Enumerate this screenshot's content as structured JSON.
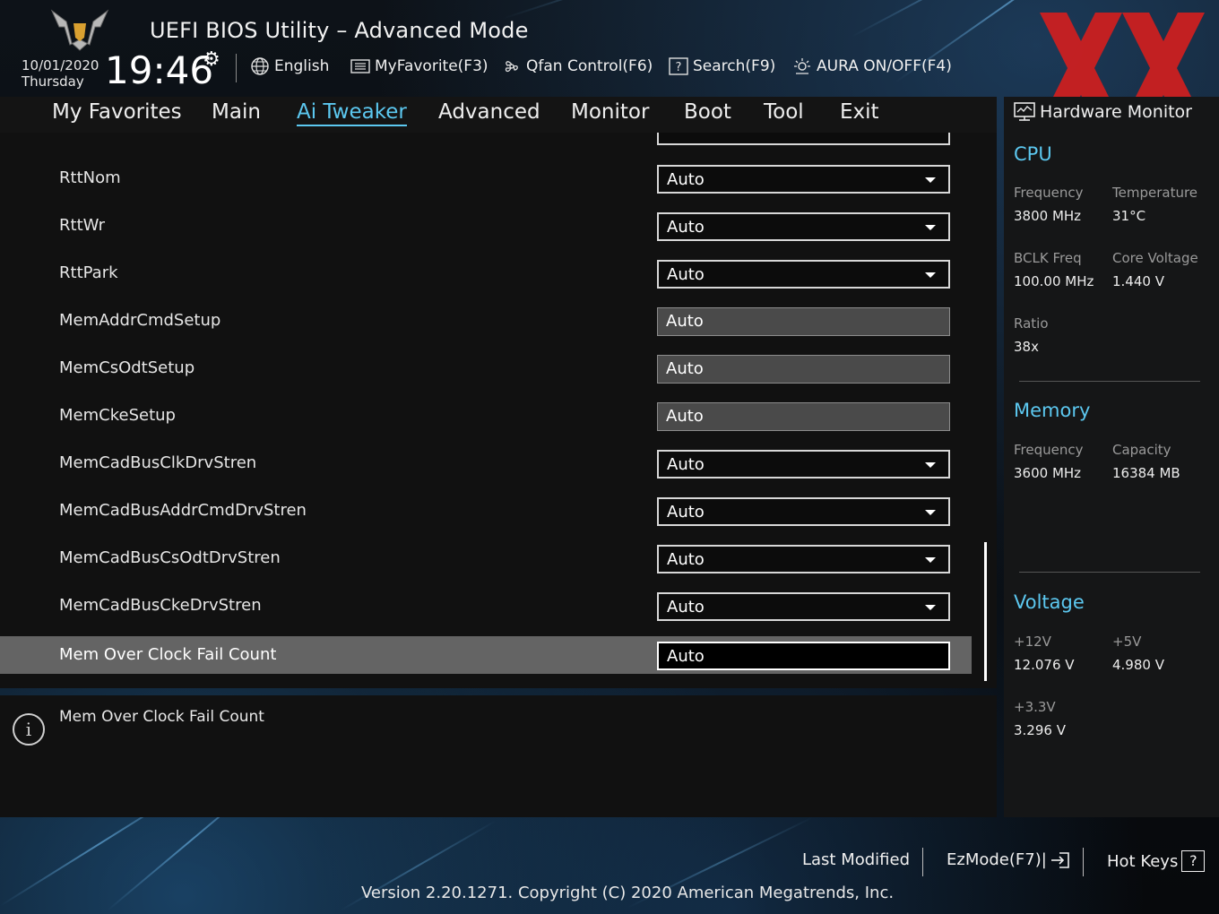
{
  "header": {
    "title": "UEFI BIOS Utility – Advanced Mode",
    "date": "10/01/2020",
    "day": "Thursday",
    "time": "19:46",
    "links": {
      "language": "English",
      "myfavorite": "MyFavorite(F3)",
      "qfan": "Qfan Control(F6)",
      "search": "Search(F9)",
      "aura": "AURA ON/OFF(F4)"
    }
  },
  "nav": {
    "tabs": [
      "My Favorites",
      "Main",
      "Ai Tweaker",
      "Advanced",
      "Monitor",
      "Boot",
      "Tool",
      "Exit"
    ],
    "active": "Ai Tweaker"
  },
  "settings": [
    {
      "label": "RttNom",
      "value": "Auto",
      "type": "dropdown"
    },
    {
      "label": "RttWr",
      "value": "Auto",
      "type": "dropdown"
    },
    {
      "label": "RttPark",
      "value": "Auto",
      "type": "dropdown"
    },
    {
      "label": "MemAddrCmdSetup",
      "value": "Auto",
      "type": "readonly"
    },
    {
      "label": "MemCsOdtSetup",
      "value": "Auto",
      "type": "readonly"
    },
    {
      "label": "MemCkeSetup",
      "value": "Auto",
      "type": "readonly"
    },
    {
      "label": "MemCadBusClkDrvStren",
      "value": "Auto",
      "type": "dropdown"
    },
    {
      "label": "MemCadBusAddrCmdDrvStren",
      "value": "Auto",
      "type": "dropdown"
    },
    {
      "label": "MemCadBusCsOdtDrvStren",
      "value": "Auto",
      "type": "dropdown"
    },
    {
      "label": "MemCadBusCkeDrvStren",
      "value": "Auto",
      "type": "dropdown"
    },
    {
      "label": "Mem Over Clock Fail Count",
      "value": "Auto",
      "type": "input",
      "selected": true
    }
  ],
  "help": {
    "text": "Mem Over Clock Fail Count"
  },
  "hardware_monitor": {
    "title": "Hardware Monitor",
    "cpu": {
      "heading": "CPU",
      "frequency_label": "Frequency",
      "frequency": "3800 MHz",
      "temperature_label": "Temperature",
      "temperature": "31°C",
      "bclk_label": "BCLK Freq",
      "bclk": "100.00 MHz",
      "core_voltage_label": "Core Voltage",
      "core_voltage": "1.440 V",
      "ratio_label": "Ratio",
      "ratio": "38x"
    },
    "memory": {
      "heading": "Memory",
      "frequency_label": "Frequency",
      "frequency": "3600 MHz",
      "capacity_label": "Capacity",
      "capacity": "16384 MB"
    },
    "voltage": {
      "heading": "Voltage",
      "v12_label": "+12V",
      "v12": "12.076 V",
      "v5_label": "+5V",
      "v5": "4.980 V",
      "v33_label": "+3.3V",
      "v33": "3.296 V"
    }
  },
  "footer": {
    "last_modified": "Last Modified",
    "ezmode": "EzMode(F7)|",
    "hotkeys": "Hot Keys",
    "hotkeys_box": "?",
    "version": "Version 2.20.1271. Copyright (C) 2020 American Megatrends, Inc."
  },
  "colors": {
    "accent": "#5cc8f0",
    "selected_row": "#646464",
    "panel": "#111111",
    "watermark": "#d11f1f"
  },
  "icons": {
    "logo": "tuf-gaming-logo",
    "gear": "gear-icon",
    "globe": "globe-icon",
    "favorite": "list-icon",
    "fan": "fan-icon",
    "search": "question-box-icon",
    "aura": "light-icon",
    "monitor": "monitor-icon",
    "info": "info-icon",
    "exit": "exit-icon"
  }
}
